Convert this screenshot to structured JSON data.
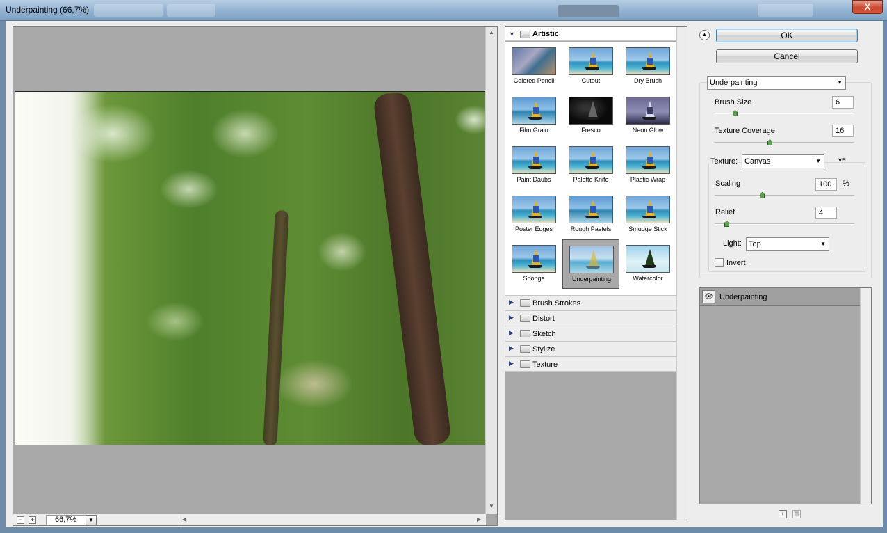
{
  "window": {
    "title": "Underpainting (66,7%)",
    "close_label": "X"
  },
  "preview": {
    "zoom_value": "66,7%",
    "zoom_out_label": "−",
    "zoom_in_label": "+"
  },
  "gallery": {
    "artistic_label": "Artistic",
    "thumbnails": [
      {
        "name": "Colored Pencil"
      },
      {
        "name": "Cutout"
      },
      {
        "name": "Dry Brush"
      },
      {
        "name": "Film Grain"
      },
      {
        "name": "Fresco"
      },
      {
        "name": "Neon Glow"
      },
      {
        "name": "Paint Daubs"
      },
      {
        "name": "Palette Knife"
      },
      {
        "name": "Plastic Wrap"
      },
      {
        "name": "Poster Edges"
      },
      {
        "name": "Rough Pastels"
      },
      {
        "name": "Smudge Stick"
      },
      {
        "name": "Sponge"
      },
      {
        "name": "Underpainting"
      },
      {
        "name": "Watercolor"
      }
    ],
    "selected": "Underpainting",
    "categories": [
      "Brush Strokes",
      "Distort",
      "Sketch",
      "Stylize",
      "Texture"
    ]
  },
  "buttons": {
    "ok_label": "OK",
    "cancel_label": "Cancel"
  },
  "settings": {
    "filter_select": "Underpainting",
    "brush_size": {
      "label": "Brush Size",
      "value": "6",
      "level": 0.15
    },
    "texture_coverage": {
      "label": "Texture Coverage",
      "value": "16",
      "level": 0.39
    },
    "texture": {
      "label": "Texture:",
      "value": "Canvas"
    },
    "scaling": {
      "label": "Scaling",
      "value": "100",
      "unit": "%",
      "level": 0.33
    },
    "relief": {
      "label": "Relief",
      "value": "4",
      "level": 0.08
    },
    "light": {
      "label": "Light:",
      "value": "Top"
    },
    "invert": {
      "label": "Invert",
      "checked": false
    }
  },
  "layers": {
    "items": [
      {
        "name": "Underpainting"
      }
    ]
  }
}
